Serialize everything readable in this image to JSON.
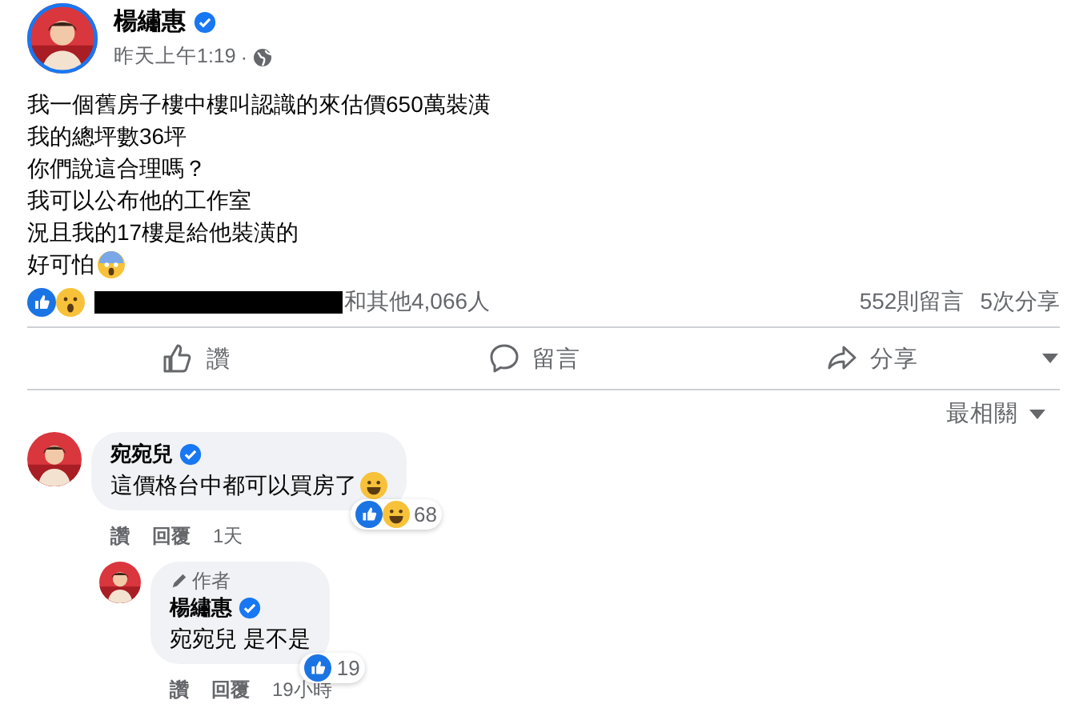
{
  "post": {
    "author": "楊繡惠",
    "verified": true,
    "time": "昨天上午1:19",
    "audience_separator": "·",
    "body": [
      "我一個舊房子樓中樓叫認識的來估價650萬裝潢",
      "我的總坪數36坪",
      "你們說這合理嗎？",
      "我可以公布他的工作室",
      "況且我的17樓是給他裝潢的",
      "好可怕"
    ],
    "reactions_text": "和其他4,066人",
    "comments_count": "552則留言",
    "shares_count": "5次分享"
  },
  "actions": [
    {
      "label": "讚",
      "kind": "like"
    },
    {
      "label": "留言",
      "kind": "comment"
    },
    {
      "label": "分享",
      "kind": "share"
    }
  ],
  "sort": {
    "label": "最相關"
  },
  "comments": [
    {
      "author": "宛宛兒",
      "verified": true,
      "text": "這價格台中都可以買房了",
      "reaction_count": "68",
      "like": "讚",
      "reply": "回覆",
      "time": "1天",
      "replies": [
        {
          "badge": "作者",
          "author": "楊繡惠",
          "verified": true,
          "text": "宛宛兒 是不是",
          "reaction_count": "19",
          "like": "讚",
          "reply": "回覆",
          "time": "19小時"
        }
      ]
    }
  ]
}
